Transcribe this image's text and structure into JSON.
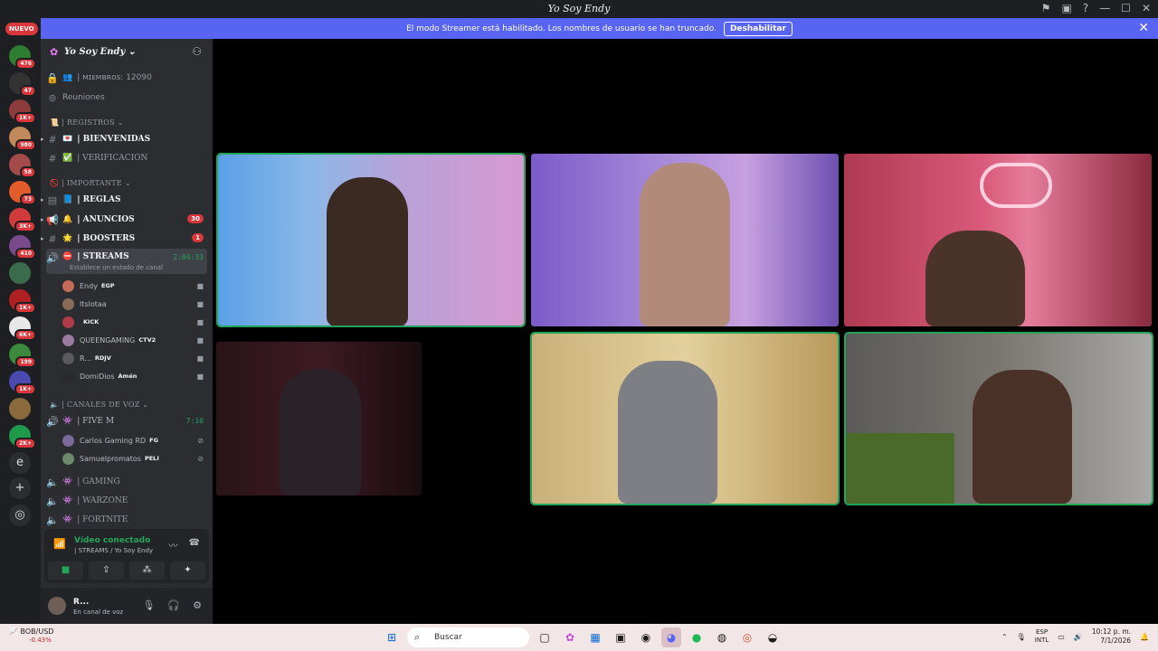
{
  "window": {
    "title": "Yo Soy Endy"
  },
  "banner": {
    "text": "El modo Streamer está habilitado. Los nombres de usuario se han truncado.",
    "button": "Deshabilitar"
  },
  "guilds": {
    "new_label": "NUEVO",
    "items": [
      {
        "badge": "476",
        "color": "#2f7d32"
      },
      {
        "badge": "47",
        "color": "#333333"
      },
      {
        "badge": "1K+",
        "color": "#8e3b3b"
      },
      {
        "badge": "980",
        "color": "#c28a5a"
      },
      {
        "badge": "58",
        "color": "#a34b4b"
      },
      {
        "badge": "73",
        "color": "#e35d2b"
      },
      {
        "badge": "3K+",
        "color": "#d23b3b"
      },
      {
        "badge": "410",
        "color": "#7a4b8c"
      },
      {
        "badge": "",
        "color": "#3a6b4a"
      },
      {
        "badge": "1K+",
        "color": "#b02020"
      },
      {
        "badge": "6K+",
        "color": "#e8e8e8"
      },
      {
        "badge": "199",
        "color": "#3c8a3c"
      },
      {
        "badge": "1K+",
        "color": "#4a4ab0"
      },
      {
        "badge": "",
        "color": "#8a6a3a"
      },
      {
        "badge": "2K+",
        "color": "#1f9a4a"
      }
    ],
    "text_icon": "e"
  },
  "server": {
    "name": "Yo Soy Endy",
    "members_label": "| ᴍɪᴇᴍʙʀᴏs: 12090",
    "meetings": "Reuniones",
    "categories": {
      "registros": "| REGISTROS",
      "importante": "| IMPORTANTE",
      "voz": "| CANALES DE VOZ"
    },
    "channels": {
      "bienvenidas": "| BIENVENIDAS",
      "verificacion": "| VERIFICACION",
      "reglas": "| REGLAS",
      "anuncios": "| ANUNCIOS",
      "anuncios_badge": "30",
      "boosters": "| BOOSTERS",
      "boosters_badge": "1",
      "streams": "| STREAMS",
      "streams_status": "Establece un estado de canal",
      "streams_timer": "2:04:33",
      "fivem": "| FIVE M",
      "fivem_timer": "7:10",
      "gaming": "| GAMING",
      "warzone": "| WARZONE",
      "fortnite": "| FORTNITE"
    },
    "stream_users": [
      {
        "name": "Endy",
        "tag": "EGP",
        "color": "#c46b5a"
      },
      {
        "name": "Itslotaa",
        "tag": "",
        "color": "#8a6b5a"
      },
      {
        "name": "",
        "tag": "KICK",
        "color": "#b03a4a"
      },
      {
        "name": "QUEENGAMING",
        "tag": "CTV2",
        "color": "#9a7aa0"
      },
      {
        "name": "R...",
        "tag": "RDJV",
        "color": "#5a5a5a"
      },
      {
        "name": "DomiDios",
        "tag": "Amén",
        "color": "#2a2a2a"
      }
    ],
    "fivem_users": [
      {
        "name": "Carlos Gaming RD",
        "tag": "FG",
        "color": "#7a6a9a"
      },
      {
        "name": "Samuelpromatos",
        "tag": "PELI",
        "color": "#6a8a6a"
      }
    ]
  },
  "voice_panel": {
    "title": "Vídeo conectado",
    "subtitle": "| STREAMS / Yo Soy Endy"
  },
  "user": {
    "name": "R...",
    "status": "En canal de voz"
  },
  "taskbar": {
    "weather_label": "BOB/USD",
    "weather_value": "-0.43%",
    "search": "Buscar",
    "lang_1": "ESP",
    "lang_2": "INTL",
    "time": "10:12 p. m.",
    "date": "7/1/2026"
  }
}
